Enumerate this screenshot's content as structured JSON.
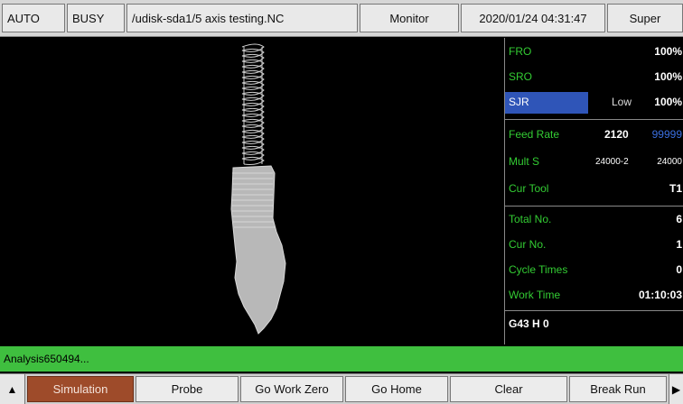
{
  "statusbar": {
    "mode": "AUTO",
    "state": "BUSY",
    "file": "/udisk-sda1/5 axis testing.NC",
    "view": "Monitor",
    "datetime": "2020/01/24 04:31:47",
    "user": "Super"
  },
  "panel": {
    "fro": {
      "label": "FRO",
      "value": "100%"
    },
    "sro": {
      "label": "SRO",
      "value": "100%"
    },
    "sjr": {
      "label": "SJR",
      "level": "Low",
      "value": "100%"
    },
    "feed_rate": {
      "label": "Feed Rate",
      "actual": "2120",
      "set": "99999"
    },
    "mult_s": {
      "label": "Mult S",
      "actual": "24000-2",
      "set": "24000"
    },
    "cur_tool": {
      "label": "Cur Tool",
      "value": "T1"
    },
    "total_no": {
      "label": "Total No.",
      "value": "6"
    },
    "cur_no": {
      "label": "Cur No.",
      "value": "1"
    },
    "cycle_times": {
      "label": "Cycle Times",
      "value": "0"
    },
    "work_time": {
      "label": "Work Time",
      "value": "01:10:03"
    },
    "gcode": "G43 H 0"
  },
  "message": "Analysis650494...",
  "softkeys": {
    "left_arrow": "▲",
    "right_arrow": "▶",
    "keys": [
      "Simulation",
      "Probe",
      "Go Work Zero",
      "Go Home",
      "Clear",
      "Break Run"
    ]
  },
  "colors": {
    "label_green": "#33cc33",
    "selected_blue": "#2f55b8",
    "message_green": "#3fbf3f",
    "active_key": "#9e4b2a",
    "set_value_blue": "#3a6fe0"
  }
}
